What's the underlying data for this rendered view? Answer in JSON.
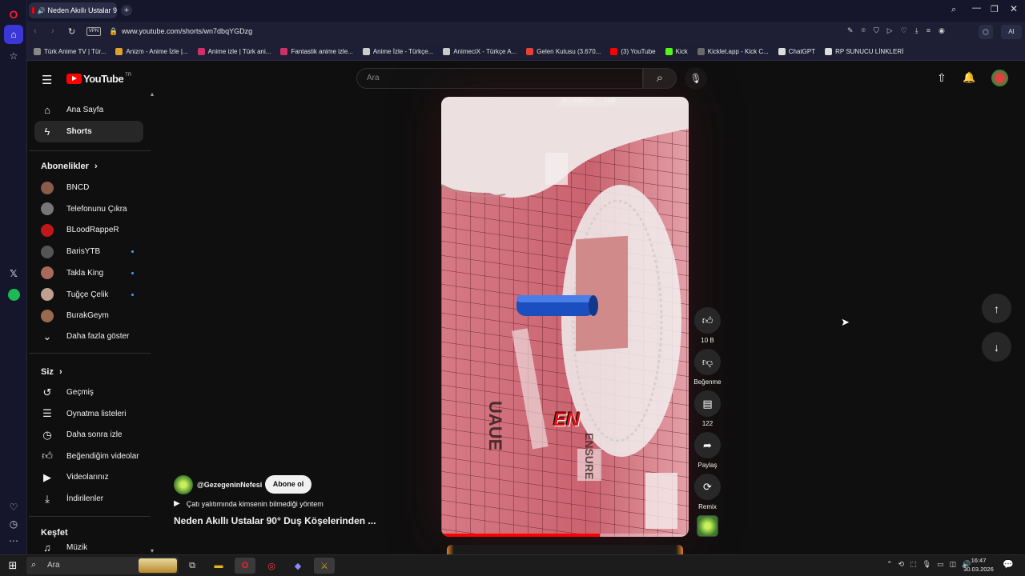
{
  "browser": {
    "tab_title": "Neden Akıllı Ustalar 9",
    "url": "www.youtube.com/shorts/wn7dbqYGDzg",
    "vpn_label": "VPN",
    "ai_label": "AI",
    "bookmarks": [
      {
        "label": "Türk Anime TV | Tür...",
        "color": "#888888"
      },
      {
        "label": "Anizm - Anime İzle |...",
        "color": "#e0a030"
      },
      {
        "label": "Anime izle | Türk ani...",
        "color": "#d0306a"
      },
      {
        "label": "Fantastik anime izle...",
        "color": "#d0306a"
      },
      {
        "label": "Anime İzle - Türkçe...",
        "color": "#cccccc"
      },
      {
        "label": "AnimeciX - Türkçe A...",
        "color": "#cccccc"
      },
      {
        "label": "Gelen Kutusu (3.670...",
        "color": "#ea4335"
      },
      {
        "label": "(3) YouTube",
        "color": "#ff0000"
      },
      {
        "label": "Kick",
        "color": "#53fc18"
      },
      {
        "label": "Kicklet.app - Kick C...",
        "color": "#6a6a6a"
      },
      {
        "label": "ChatGPT",
        "color": "#dddddd"
      },
      {
        "label": "RP SUNUCU LİNKLERİ",
        "color": "#dddddd"
      }
    ]
  },
  "youtube": {
    "logo": "YouTube",
    "region": "TR",
    "search_placeholder": "Ara",
    "nav": [
      {
        "label": "Ana Sayfa",
        "icon": "home-icon"
      },
      {
        "label": "Shorts",
        "icon": "shorts-icon"
      }
    ],
    "subscriptions_title": "Abonelikler",
    "subscriptions": [
      {
        "label": "BNCD",
        "color": "#8a5a4a",
        "dot": false
      },
      {
        "label": "Telefonunu Çıkra",
        "color": "#777777",
        "dot": false
      },
      {
        "label": "BLoodRappeR",
        "color": "#c01818",
        "dot": false
      },
      {
        "label": "BarisYTB",
        "color": "#555555",
        "dot": true
      },
      {
        "label": "Takla King",
        "color": "#a86a5a",
        "dot": true
      },
      {
        "label": "Tuğçe Çelik",
        "color": "#c0a090",
        "dot": true
      },
      {
        "label": "BurakGeym",
        "color": "#9a6a50",
        "dot": false
      }
    ],
    "show_more": "Daha fazla göster",
    "you_title": "Siz",
    "you_items": [
      {
        "label": "Geçmiş",
        "icon": "history-icon"
      },
      {
        "label": "Oynatma listeleri",
        "icon": "playlist-icon"
      },
      {
        "label": "Daha sonra izle",
        "icon": "clock-icon"
      },
      {
        "label": "Beğendiğim videolar",
        "icon": "thumbs-up-icon"
      },
      {
        "label": "Videolarınız",
        "icon": "video-icon"
      },
      {
        "label": "İndirilenler",
        "icon": "download-icon"
      }
    ],
    "explore_title": "Keşfet",
    "explore_items": [
      {
        "label": "Müzik",
        "icon": "music-icon"
      }
    ],
    "short": {
      "channel": "@GezegeninNefesi",
      "subscribe": "Abone ol",
      "audio": "Çatı yalıtımında kimsenin bilmediği yöntem",
      "title": "Neden Akıllı Ustalar 90° Duş Köşelerinden ...",
      "overlay_banner": "Bu video'yu ... indir",
      "video_text": "EN",
      "likes": "10 B",
      "dislike": "Beğenme",
      "comments": "122",
      "share": "Paylaş",
      "remix": "Remix",
      "progress": 0.64
    }
  },
  "taskbar": {
    "search": "Ara",
    "time": "16:47",
    "date": "30.03.2026"
  }
}
